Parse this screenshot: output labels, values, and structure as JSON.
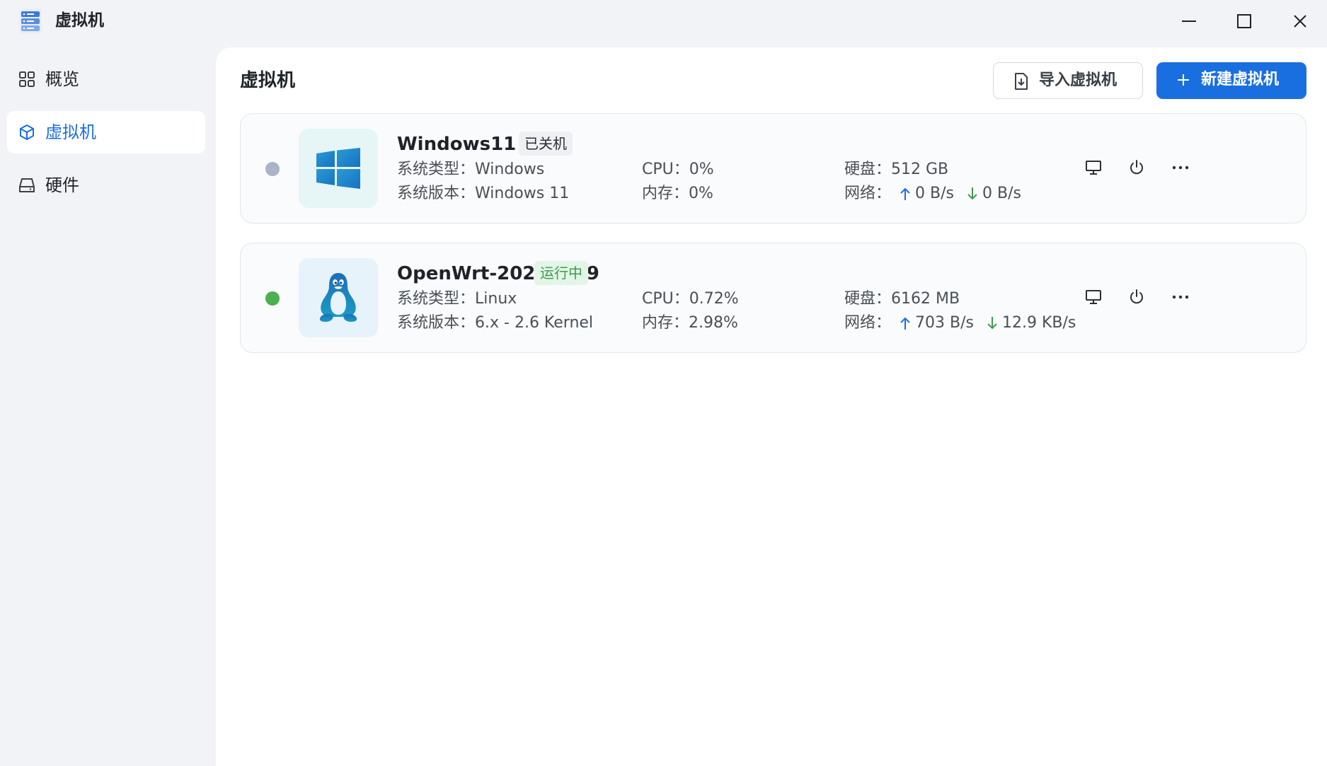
{
  "app": {
    "title": "虚拟机",
    "icon": "server-stack-icon"
  },
  "window_controls": {
    "minimize": "minimize-icon",
    "maximize": "maximize-icon",
    "close": "close-icon"
  },
  "sidebar": {
    "items": [
      {
        "label": "概览",
        "icon": "grid-icon",
        "active": false
      },
      {
        "label": "虚拟机",
        "icon": "cube-icon",
        "active": true
      },
      {
        "label": "硬件",
        "icon": "hard-drive-icon",
        "active": false
      }
    ]
  },
  "main": {
    "title": "虚拟机",
    "import_button": "导入虚拟机",
    "new_button": "新建虚拟机",
    "new_button_icon": "plus-icon",
    "import_button_icon": "import-file-icon"
  },
  "labels": {
    "os_type": "系统类型：",
    "os_version": "系统版本：",
    "cpu": "CPU：",
    "memory": "内存：",
    "disk": "硬盘：",
    "network": "网络："
  },
  "vms": [
    {
      "name": "Windows11",
      "status": "已关机",
      "running": false,
      "status_color": "#a9b4c6",
      "os_icon": "windows-logo-icon",
      "os_type": "Windows",
      "os_version": "Windows 11",
      "cpu": "0%",
      "memory": "0%",
      "disk": "512 GB",
      "net_up": "0 B/s",
      "net_down": "0 B/s"
    },
    {
      "name": "OpenWrt-20260329",
      "status": "运行中",
      "running": true,
      "status_color": "#4caf50",
      "os_icon": "linux-tux-icon",
      "os_type": "Linux",
      "os_version": "6.x - 2.6 Kernel",
      "cpu": "0.72%",
      "memory": "2.98%",
      "disk": "6162 MB",
      "net_up": "703 B/s",
      "net_down": "12.9 KB/s"
    }
  ],
  "colors": {
    "accent": "#1a6fe0",
    "running": "#4caf50",
    "stopped": "#a9b4c6"
  }
}
